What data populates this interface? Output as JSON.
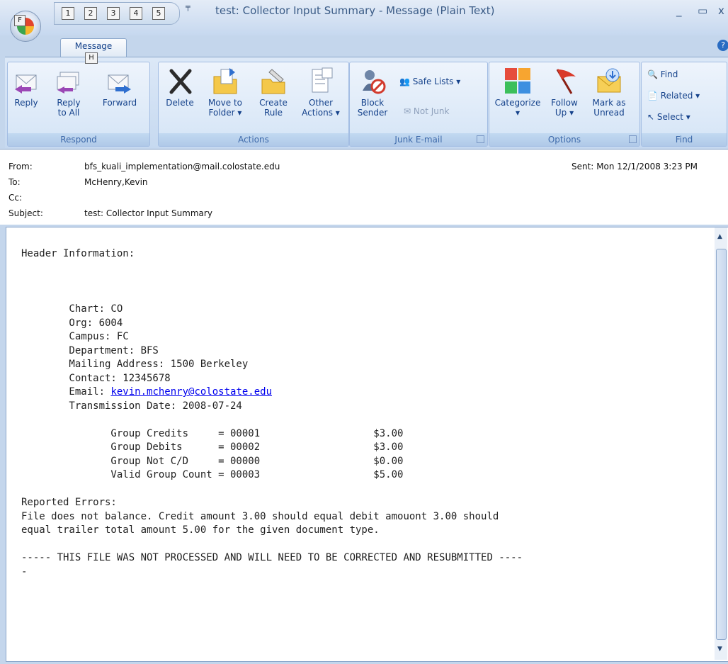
{
  "window": {
    "title": "test: Collector Input Summary - Message (Plain Text)",
    "office_key": "F",
    "qat_keys": [
      "1",
      "2",
      "3",
      "4",
      "5"
    ],
    "minimize": "_",
    "maximize": "▭",
    "close": "x"
  },
  "ribbon": {
    "tab_label": "Message",
    "tab_key": "H",
    "groups": {
      "respond": {
        "label": "Respond",
        "reply": "Reply",
        "reply_all_1": "Reply",
        "reply_all_2": "to All",
        "forward": "Forward"
      },
      "actions": {
        "label": "Actions",
        "delete": "Delete",
        "move_1": "Move to",
        "move_2": "Folder ▾",
        "rule_1": "Create",
        "rule_2": "Rule",
        "other_1": "Other",
        "other_2": "Actions ▾"
      },
      "junk": {
        "label": "Junk E-mail",
        "block_1": "Block",
        "block_2": "Sender",
        "safe_lists": "Safe Lists ▾",
        "not_junk": "Not Junk"
      },
      "options": {
        "label": "Options",
        "categorize_1": "Categorize",
        "categorize_2": "▾",
        "follow_1": "Follow",
        "follow_2": "Up ▾",
        "mark_1": "Mark as",
        "mark_2": "Unread"
      },
      "find": {
        "label": "Find",
        "find": "Find",
        "related": "Related ▾",
        "select": "Select ▾"
      }
    }
  },
  "header": {
    "from_label": "From:",
    "from": "bfs_kuali_implementation@mail.colostate.edu",
    "to_label": "To:",
    "to": "McHenry,Kevin",
    "cc_label": "Cc:",
    "cc": "",
    "subject_label": "Subject:",
    "subject": "test: Collector Input Summary",
    "sent_label": "Sent:",
    "sent": "Mon 12/1/2008 3:23 PM"
  },
  "body": {
    "l1": "Header Information:",
    "chart": "        Chart: CO",
    "org": "        Org: 6004",
    "campus": "        Campus: FC",
    "dept": "        Department: BFS",
    "mailing": "        Mailing Address: 1500 Berkeley",
    "contact": "        Contact: 12345678",
    "email_prefix": "        Email: ",
    "email": "kevin.mchenry@colostate.edu",
    "transmission": "        Transmission Date: 2008-07-24",
    "g1": "               Group Credits     = 00001                   $3.00",
    "g2": "               Group Debits      = 00002                   $3.00",
    "g3": "               Group Not C/D     = 00000                   $0.00",
    "g4": "               Valid Group Count = 00003                   $5.00",
    "errors_title": "Reported Errors:",
    "err1": "File does not balance. Credit amount 3.00 should equal debit amouont 3.00 should",
    "err2": "equal trailer total amount 5.00 for the given document type.",
    "final1": "----- THIS FILE WAS NOT PROCESSED AND WILL NEED TO BE CORRECTED AND RESUBMITTED ----",
    "final2": "-"
  }
}
